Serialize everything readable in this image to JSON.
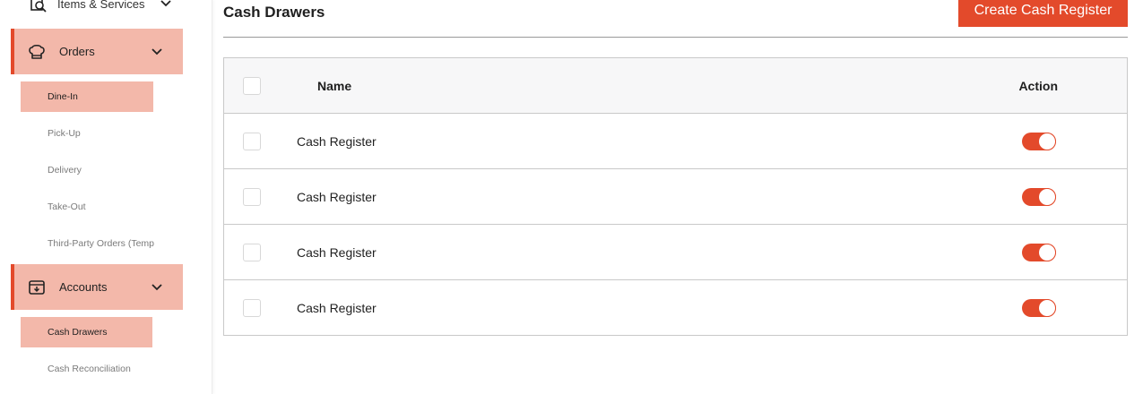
{
  "sidebar": {
    "top_item": {
      "label": "Items & Services",
      "icon": "search-document-icon"
    },
    "groups": [
      {
        "label": "Orders",
        "icon": "chef-hat-icon",
        "items": [
          {
            "label": "Dine-In",
            "active": true
          },
          {
            "label": "Pick-Up",
            "active": false
          },
          {
            "label": "Delivery",
            "active": false
          },
          {
            "label": "Take-Out",
            "active": false
          },
          {
            "label": "Third-Party Orders (Temp",
            "active": false
          }
        ]
      },
      {
        "label": "Accounts",
        "icon": "cash-register-icon",
        "items": [
          {
            "label": "Cash Drawers",
            "active": true
          },
          {
            "label": "Cash Reconciliation",
            "active": false
          }
        ]
      }
    ]
  },
  "main": {
    "title": "Cash Drawers",
    "create_button": "Create Cash Register",
    "table": {
      "headers": {
        "name": "Name",
        "action": "Action"
      },
      "rows": [
        {
          "name": "Cash Register",
          "enabled": true
        },
        {
          "name": "Cash Register",
          "enabled": true
        },
        {
          "name": "Cash Register",
          "enabled": true
        },
        {
          "name": "Cash Register",
          "enabled": true
        }
      ]
    }
  },
  "colors": {
    "accent": "#e34a2b",
    "highlight": "#f3b8aa"
  }
}
